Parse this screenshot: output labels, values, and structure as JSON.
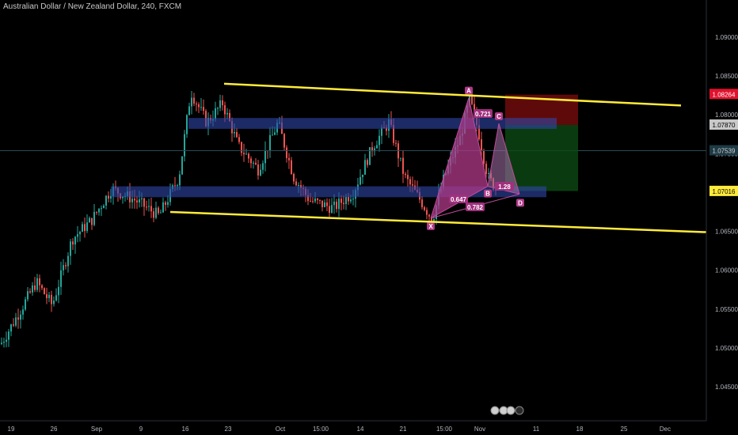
{
  "header": {
    "title": "Australian Dollar / New Zealand Dollar, 240, FXCM"
  },
  "chart_data": {
    "type": "candlestick",
    "symbol": "AUDNZD",
    "timeframe": "240",
    "source": "FXCM",
    "ylim": [
      1.0405,
      1.0935
    ],
    "y_ticks": [
      "1.09000",
      "1.08500",
      "1.08000",
      "1.07500",
      "1.07000",
      "1.06500",
      "1.06000",
      "1.05500",
      "1.05000",
      "1.04500"
    ],
    "x_ticks": [
      "19",
      "26",
      "Sep",
      "9",
      "16",
      "23",
      "Oct",
      "15:00",
      "14",
      "21",
      "15:00",
      "Nov",
      "11",
      "18",
      "25",
      "Dec"
    ],
    "price_badges": [
      {
        "value": "1.08264",
        "color": "#e0112d",
        "text_color": "#ffffff"
      },
      {
        "value": "1.07870",
        "color": "#c8c8c8",
        "text_color": "#000000"
      },
      {
        "value": "1.07539",
        "color": "#1e3a44",
        "text_color": "#d0d0d0"
      },
      {
        "value": "1.07016",
        "color": "#ffeb3b",
        "text_color": "#000000"
      }
    ],
    "trend_lines": [
      {
        "name": "upper",
        "from": 1.084,
        "to": 1.0812,
        "color": "#ffeb3b"
      },
      {
        "name": "lower",
        "from": 1.0675,
        "to": 1.0649,
        "color": "#ffeb3b"
      }
    ],
    "zones": [
      {
        "name": "resistance-zone",
        "high": 1.0796,
        "low": 1.0782,
        "color": "#2f46a8"
      },
      {
        "name": "support-zone",
        "high": 1.0708,
        "low": 1.0694,
        "color": "#2f46a8"
      }
    ],
    "harmonic_labels": [
      "A",
      "C",
      "B",
      "X",
      "D"
    ],
    "harmonic_ratios": [
      "0.721",
      "1.28",
      "0.647",
      "0.782"
    ],
    "position": {
      "stop": 1.0826,
      "entry": 1.0787,
      "target": 1.0702,
      "loss_color": "#7f0d0d",
      "profit_color": "#0c4a14"
    },
    "candle_colors": {
      "up": "#26a69a",
      "down": "#ef5350"
    }
  }
}
